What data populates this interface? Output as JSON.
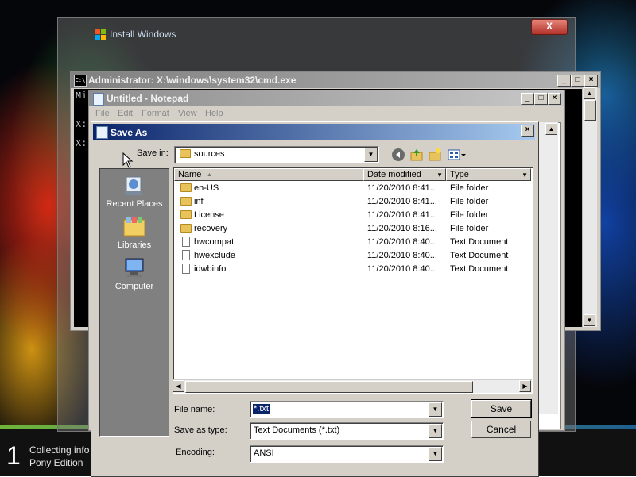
{
  "setup_window": {
    "title": "Install Windows",
    "close_label": "X"
  },
  "taskbar": {
    "step_number": "1",
    "step_line1": "Collecting info",
    "step_line2": "Pony Edition"
  },
  "cmd_window": {
    "title": "Administrator: X:\\windows\\system32\\cmd.exe",
    "lines": [
      "Mi",
      "",
      "X:",
      "",
      "X:"
    ]
  },
  "notepad": {
    "title": "Untitled - Notepad",
    "menu": [
      "File",
      "Edit",
      "Format",
      "View",
      "Help"
    ]
  },
  "save_dialog": {
    "title": "Save As",
    "save_in_label": "Save in:",
    "save_in_value": "sources",
    "places": [
      "Recent Places",
      "Libraries",
      "Computer"
    ],
    "columns": [
      "Name",
      "Date modified",
      "Type"
    ],
    "files": [
      {
        "name": "en-US",
        "date": "11/20/2010 8:41...",
        "type": "File folder",
        "kind": "folder"
      },
      {
        "name": "inf",
        "date": "11/20/2010 8:41...",
        "type": "File folder",
        "kind": "folder"
      },
      {
        "name": "License",
        "date": "11/20/2010 8:41...",
        "type": "File folder",
        "kind": "folder"
      },
      {
        "name": "recovery",
        "date": "11/20/2010 8:16...",
        "type": "File folder",
        "kind": "folder"
      },
      {
        "name": "hwcompat",
        "date": "11/20/2010 8:40...",
        "type": "Text Document",
        "kind": "doc"
      },
      {
        "name": "hwexclude",
        "date": "11/20/2010 8:40...",
        "type": "Text Document",
        "kind": "doc"
      },
      {
        "name": "idwbinfo",
        "date": "11/20/2010 8:40...",
        "type": "Text Document",
        "kind": "doc"
      }
    ],
    "file_name_label": "File name:",
    "file_name_value": "*.txt",
    "save_as_type_label": "Save as type:",
    "save_as_type_value": "Text Documents (*.txt)",
    "encoding_label": "Encoding:",
    "encoding_value": "ANSI",
    "save_button": "Save",
    "cancel_button": "Cancel"
  },
  "colors": {
    "dialog_title": "#0a246a",
    "face": "#d4d0c8",
    "folder": "#e8c25a"
  }
}
